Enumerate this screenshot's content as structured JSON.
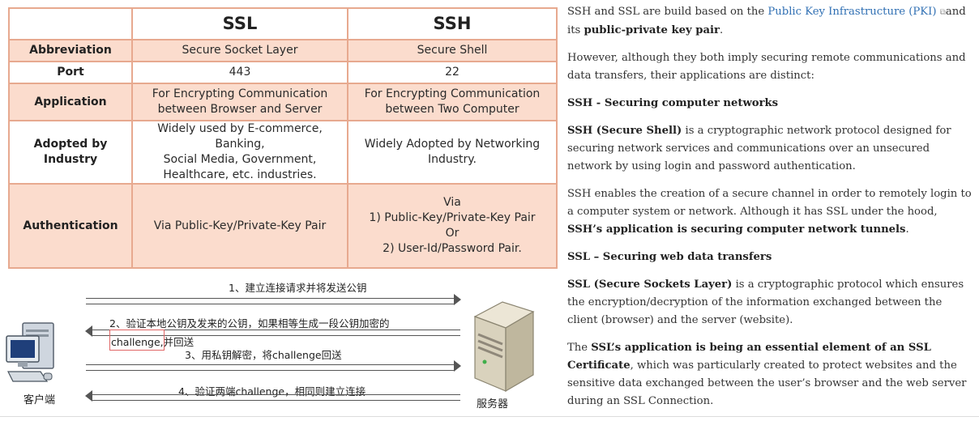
{
  "table": {
    "headers": [
      "",
      "SSL",
      "SSH"
    ],
    "rows": [
      {
        "label": "Abbreviation",
        "ssl": "Secure Socket Layer",
        "ssh": "Secure Shell"
      },
      {
        "label": "Port",
        "ssl": "443",
        "ssh": "22"
      },
      {
        "label": "Application",
        "ssl": "For Encrypting Communication\nbetween Browser and Server",
        "ssh": "For Encrypting Communication\nbetween Two Computer"
      },
      {
        "label": "Adopted by\nIndustry",
        "ssl": "Widely used by E-commerce, Banking,\nSocial Media, Government,\nHealthcare, etc. industries.",
        "ssh": "Widely Adopted by Networking\nIndustry."
      },
      {
        "label": "Authentication",
        "ssl": "Via Public-Key/Private-Key Pair",
        "ssh": "Via\n1) Public-Key/Private-Key Pair\nOr\n2) User-Id/Password Pair."
      }
    ]
  },
  "diagram": {
    "step1": "1、建立连接请求并将发送公钥",
    "step2_line1": "2、验证本地公钥及发来的公钥，如果相等生成一段公钥加密的",
    "step2_line2": "challenge,并回送",
    "step3": "3、用私钥解密，将challenge回送",
    "step4": "4、验证两端challenge，相同则建立连接",
    "client_label": "客户端",
    "server_label": "服务器"
  },
  "article": {
    "p1_pre": "SSH and SSL are build based on the ",
    "p1_link": "Public Key Infrastructure (PKI)",
    "p1_mid": "and its ",
    "p1_bold": "public-private key pair",
    "p1_end": ".",
    "p2": "However, although they both imply securing remote communications and data transfers, their applications are distinct:",
    "h_ssh": "SSH - Securing computer networks",
    "p3_bold": "SSH (Secure Shell)",
    "p3_rest": " is a cryptographic network protocol designed for securing network services and communications over an unsecured network by using login and password authentication.",
    "p4_pre": "SSH enables the creation of a secure channel in order to remotely login to a computer system or network. Although it has SSL under the hood, ",
    "p4_bold": "SSH’s application is securing computer network tunnels",
    "p4_end": ".",
    "h_ssl": "SSL – Securing web data transfers",
    "p5_bold": "SSL (Secure Sockets Layer)",
    "p5_rest": " is a cryptographic protocol which ensures the encryption/decryption of the information exchanged between the client (browser) and the server (website).",
    "p6_pre": "The ",
    "p6_bold": "SSL’s application is being an essential element of an SSL Certificate",
    "p6_rest": ", which was particularly created to protect websites and the sensitive data exchanged between the user’s browser and the web server during an SSL Connection."
  },
  "colors": {
    "table_border": "#e7a98f",
    "table_row_fill": "#fbdccd",
    "link": "#2f6fb3"
  }
}
